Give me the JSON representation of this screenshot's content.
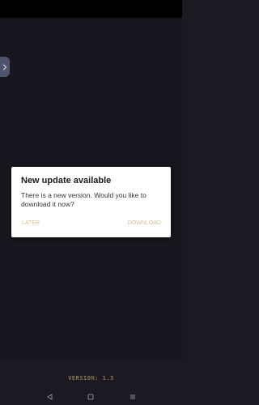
{
  "dialog": {
    "title": "New update available",
    "message": "There is a new version. Would you like to download it now?",
    "later_label": "LATER",
    "download_label": "DOWNLOAD"
  },
  "footer": {
    "version": "VERSION: 1.3"
  },
  "icons": {
    "side_tab": "chevron-right-icon",
    "nav_back": "back-triangle-icon",
    "nav_home": "home-square-icon",
    "nav_menu": "menu-lines-icon"
  },
  "colors": {
    "background": "#1c1b24",
    "accent": "#d2c08f",
    "version_text": "#8a7a4f"
  }
}
